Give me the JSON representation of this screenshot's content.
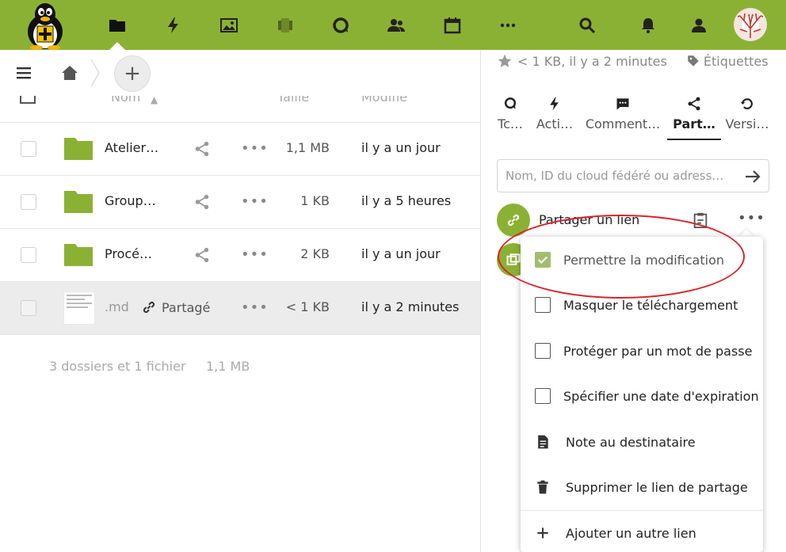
{
  "header": {
    "nav": [
      {
        "name": "files-icon"
      },
      {
        "name": "activity-icon"
      },
      {
        "name": "photos-icon"
      },
      {
        "name": "deck-icon"
      },
      {
        "name": "talk-icon"
      },
      {
        "name": "contacts-icon"
      },
      {
        "name": "calendar-icon"
      },
      {
        "name": "more-apps-icon"
      }
    ],
    "colors": {
      "brand": "#8bb134",
      "accent_checkbox": "#a3bd6e",
      "annotation": "#d6262c"
    }
  },
  "file_list": {
    "columns": {
      "name": "Nom",
      "size": "Taille",
      "modified": "Modifié"
    },
    "rows": [
      {
        "name": "Atelier…",
        "size": "1,1 MB",
        "modified": "il y a un jour",
        "type": "folder"
      },
      {
        "name": "Group…",
        "size": "1 KB",
        "modified": "il y a 5 heures",
        "type": "folder"
      },
      {
        "name": "Procé…",
        "size": "2 KB",
        "modified": "il y a un jour",
        "type": "folder"
      },
      {
        "name": ".md",
        "size": "< 1 KB",
        "modified": "il y a 2 minutes",
        "type": "file",
        "shared_label": "Partagé"
      }
    ],
    "summary": {
      "counts": "3 dossiers et 1 fichier",
      "total": "1,1 MB"
    }
  },
  "sidebar": {
    "meta": {
      "info": "< 1 KB, il y a 2 minutes",
      "tags": "Étiquettes"
    },
    "tabs": [
      {
        "label": "Tc…"
      },
      {
        "label": "Acti…"
      },
      {
        "label": "Comment…"
      },
      {
        "label": "Part…",
        "active": true
      },
      {
        "label": "Versi…"
      }
    ],
    "share_input": {
      "placeholder": "Nom, ID du cloud fédéré ou adress…"
    },
    "share_link": {
      "label": "Partager un lien"
    }
  },
  "popover": {
    "items": [
      {
        "label": "Permettre la modification",
        "checked": true
      },
      {
        "label": "Masquer le téléchargement",
        "checked": false
      },
      {
        "label": "Protéger par un mot de passe",
        "checked": false
      },
      {
        "label": "Spécifier une date d'expiration",
        "checked": false
      },
      {
        "label": "Note au destinataire"
      },
      {
        "label": "Supprimer le lien de partage"
      },
      {
        "label": "Ajouter un autre lien"
      }
    ]
  }
}
